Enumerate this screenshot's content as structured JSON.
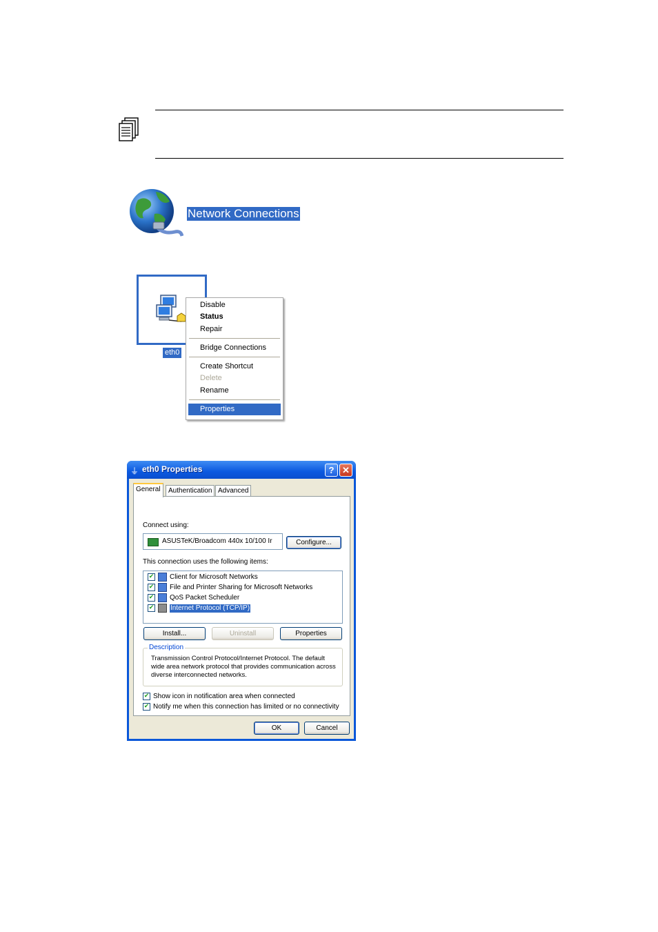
{
  "network_connections": {
    "title": "Network Connections"
  },
  "connection": {
    "name": "eth0"
  },
  "context_menu": {
    "items": [
      {
        "label": "Disable",
        "style": "normal"
      },
      {
        "label": "Status",
        "style": "bold"
      },
      {
        "label": "Repair",
        "style": "normal"
      },
      {
        "label": "Bridge Connections",
        "style": "normal"
      },
      {
        "label": "Create Shortcut",
        "style": "normal"
      },
      {
        "label": "Delete",
        "style": "disabled"
      },
      {
        "label": "Rename",
        "style": "normal"
      },
      {
        "label": "Properties",
        "style": "selected"
      }
    ]
  },
  "dialog": {
    "title": "eth0 Properties",
    "help_button": "?",
    "close_button": "✕",
    "tabs": [
      "General",
      "Authentication",
      "Advanced"
    ],
    "active_tab": "General",
    "connect_using_label": "Connect using:",
    "adapter_name": "ASUSTeK/Broadcom 440x 10/100 Ir",
    "configure_button": "Configure...",
    "items_label": "This connection uses the following items:",
    "items": [
      {
        "label": "Client for Microsoft Networks",
        "checked": true,
        "selected": false
      },
      {
        "label": "File and Printer Sharing for Microsoft Networks",
        "checked": true,
        "selected": false
      },
      {
        "label": "QoS Packet Scheduler",
        "checked": true,
        "selected": false
      },
      {
        "label": "Internet Protocol (TCP/IP)",
        "checked": true,
        "selected": true
      }
    ],
    "install_button": "Install...",
    "uninstall_button": "Uninstall",
    "properties_button": "Properties",
    "description_label": "Description",
    "description_text": "Transmission Control Protocol/Internet Protocol. The default wide area network protocol that provides communication across diverse interconnected networks.",
    "show_icon_label": "Show icon in notification area when connected",
    "show_icon_checked": true,
    "notify_label": "Notify me when this connection has limited or no connectivity",
    "notify_checked": true,
    "ok_button": "OK",
    "cancel_button": "Cancel"
  },
  "colors": {
    "selection": "#316ac5",
    "xp_title": "#0b59e0",
    "dialog_face": "#ece9d8"
  }
}
